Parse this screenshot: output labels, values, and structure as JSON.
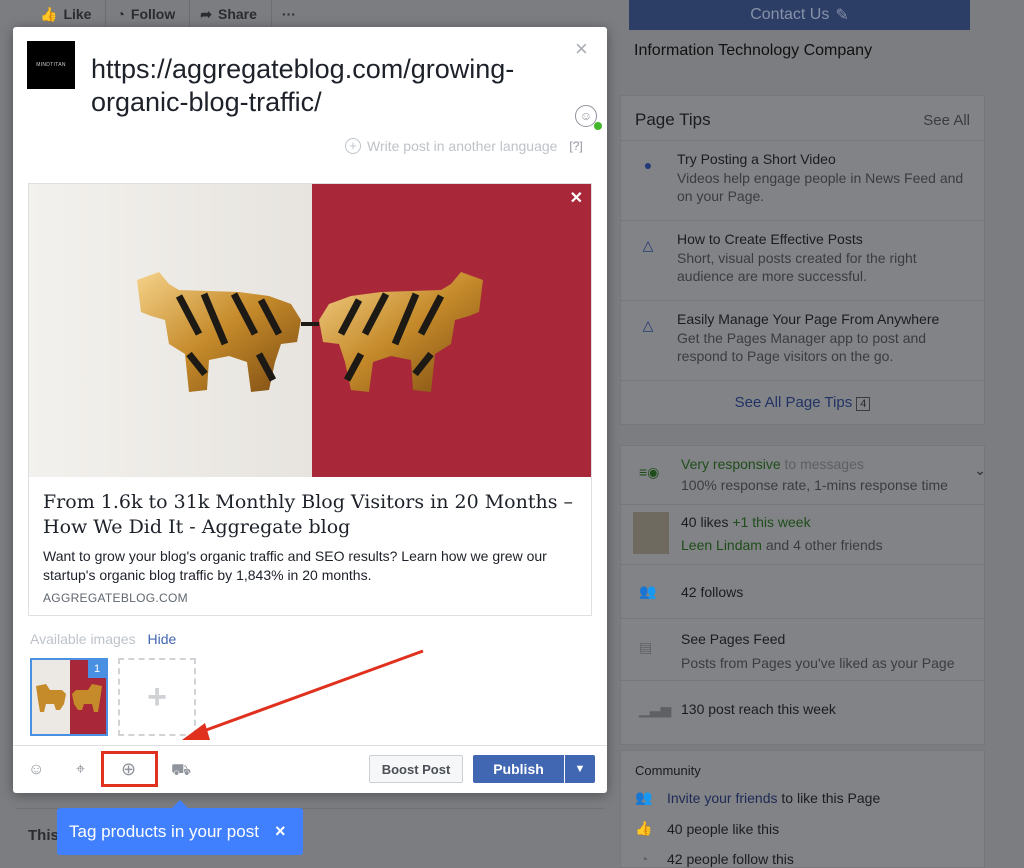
{
  "background": {
    "actions": [
      {
        "icon": "like-icon",
        "label": "Like"
      },
      {
        "icon": "rss-icon",
        "label": "Follow"
      },
      {
        "icon": "share-icon",
        "label": "Share"
      },
      {
        "icon": "more-icon",
        "label": "···"
      }
    ],
    "bottom_card_label": "This",
    "contact_button": "Contact Us",
    "category": "Information Technology Company",
    "page_tips": {
      "title": "Page Tips",
      "see_all": "See All",
      "tips": [
        {
          "title": "Try Posting a Short Video",
          "desc": "Videos help engage people in News Feed and on your Page."
        },
        {
          "title": "How to Create Effective Posts",
          "desc": "Short, visual posts created for the right audience are more successful."
        },
        {
          "title": "Easily Manage Your Page From Anywhere",
          "desc": "Get the Pages Manager app to post and respond to Page visitors on the go."
        }
      ],
      "see_all_tips": "See All Page Tips",
      "see_all_tips_count": "4"
    },
    "stats": {
      "responsive_strong": "Very responsive",
      "responsive_rest": " to messages",
      "response_rate": "100% response rate, 1-mins response time",
      "likes": "40 likes",
      "likes_week": " +1 this week",
      "friend_name": "Leen Lindam",
      "friends_rest": " and 4 other friends",
      "follows": "42 follows",
      "pages_feed_title": "See Pages Feed",
      "pages_feed_desc": "Posts from Pages you've liked as your Page",
      "reach": "130 post reach this week"
    },
    "community": {
      "title": "Community",
      "invite_link": "Invite your friends",
      "invite_rest": " to like this Page",
      "people_like": "40 people like this",
      "people_follow": "42 people follow this"
    }
  },
  "composer": {
    "avatar_text": "MINDTITAN",
    "post_text": "https://aggregateblog.com/growing-organic-blog-traffic/",
    "close": "×",
    "write_other_language": "Write post in another language",
    "help": "[?]",
    "link_preview": {
      "title": "From 1.6k to 31k Monthly Blog Visitors in 20 Months – How We Did It - Aggregate blog",
      "description": "Want to grow your blog's organic traffic and SEO results? Learn how we grew our startup's organic blog traffic by 1,843% in 20 months.",
      "domain": "AGGREGATEBLOG.COM"
    },
    "available_images_label": "Available images",
    "hide_label": "Hide",
    "thumb_number": "1",
    "boost_label": "Boost Post",
    "publish_label": "Publish"
  },
  "tooltip": {
    "text": "Tag products in your post",
    "close": "×"
  },
  "colors": {
    "primary": "#4267b2",
    "tooltip": "#4080ff",
    "highlight": "#e0301e"
  }
}
